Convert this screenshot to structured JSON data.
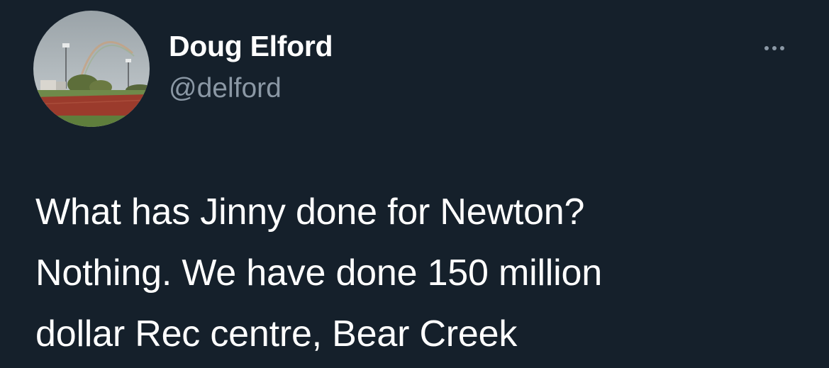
{
  "tweet": {
    "author": {
      "display_name": "Doug Elford",
      "handle": "@delford",
      "avatar_icon": "profile-photo-ballfield-rainbow"
    },
    "more_icon": "more-horizontal-icon",
    "text": "What has Jinny done for Newton?\nNothing. We have done 150 million\ndollar Rec centre, Bear Creek"
  },
  "colors": {
    "background": "#15202b",
    "primary_text": "#ffffff",
    "secondary_text": "#8b98a5"
  }
}
